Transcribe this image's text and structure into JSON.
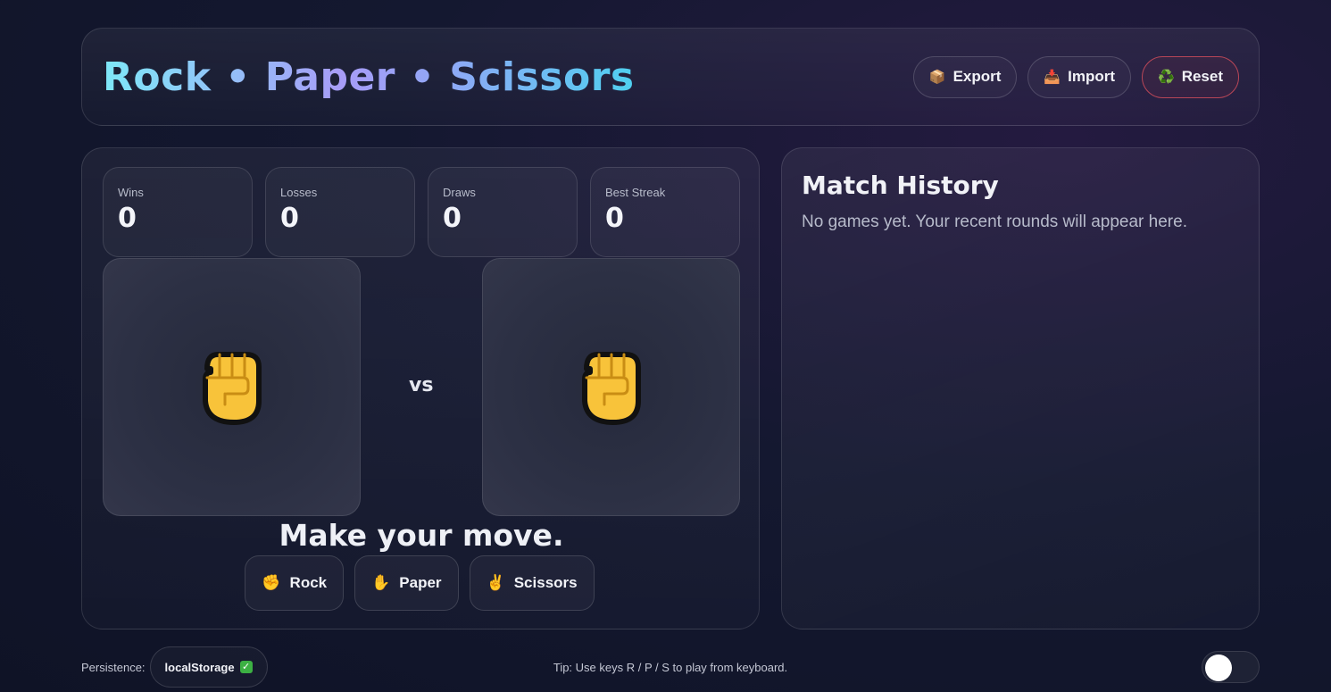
{
  "header": {
    "title": "Rock • Paper • Scissors",
    "buttons": [
      {
        "label": "Export",
        "icon": "📦"
      },
      {
        "label": "Import",
        "icon": "📥"
      },
      {
        "label": "Reset",
        "icon": "♻️"
      }
    ]
  },
  "stats": [
    {
      "label": "Wins",
      "value": "0"
    },
    {
      "label": "Losses",
      "value": "0"
    },
    {
      "label": "Draws",
      "value": "0"
    },
    {
      "label": "Best Streak",
      "value": "0"
    }
  ],
  "arena": {
    "player_hand": "✊",
    "cpu_hand": "✊",
    "vs_label": "vs",
    "message": "Make your move."
  },
  "moves": [
    {
      "label": "Rock",
      "icon": "✊"
    },
    {
      "label": "Paper",
      "icon": "✋"
    },
    {
      "label": "Scissors",
      "icon": "✌️"
    }
  ],
  "history": {
    "title": "Match History",
    "empty_text": "No games yet. Your recent rounds will appear here."
  },
  "footer": {
    "persistence_label": "Persistence:",
    "persistence_value": "localStorage",
    "persistence_check": "✓",
    "tip": "Tip: Use keys R / P / S to play from keyboard.",
    "theme_toggle_on": false
  },
  "colors": {
    "accent_reset_border": "#b84657",
    "fist_fill": "#f8c33a"
  }
}
